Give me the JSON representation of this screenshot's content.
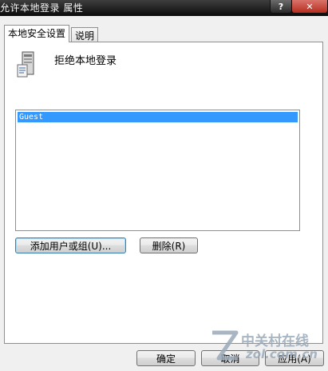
{
  "window": {
    "title": "允许本地登录 属性",
    "help_label": "?",
    "close_label": "✕"
  },
  "tabs": [
    {
      "label": "本地安全设置",
      "active": true
    },
    {
      "label": "说明",
      "active": false
    }
  ],
  "policy": {
    "icon": "server-policy-icon",
    "title": "拒绝本地登录"
  },
  "list": {
    "items": [
      "Guest"
    ],
    "selected_index": 0
  },
  "buttons": {
    "add": "添加用户或组(U)...",
    "remove": "删除(R)",
    "ok": "确定",
    "cancel": "取消",
    "apply": "应用(A)"
  },
  "watermark": {
    "cn": "中关村在线",
    "en": "zol.com.cn"
  },
  "colors": {
    "selection": "#3399ff",
    "titlebar": "#1a1a1a"
  }
}
